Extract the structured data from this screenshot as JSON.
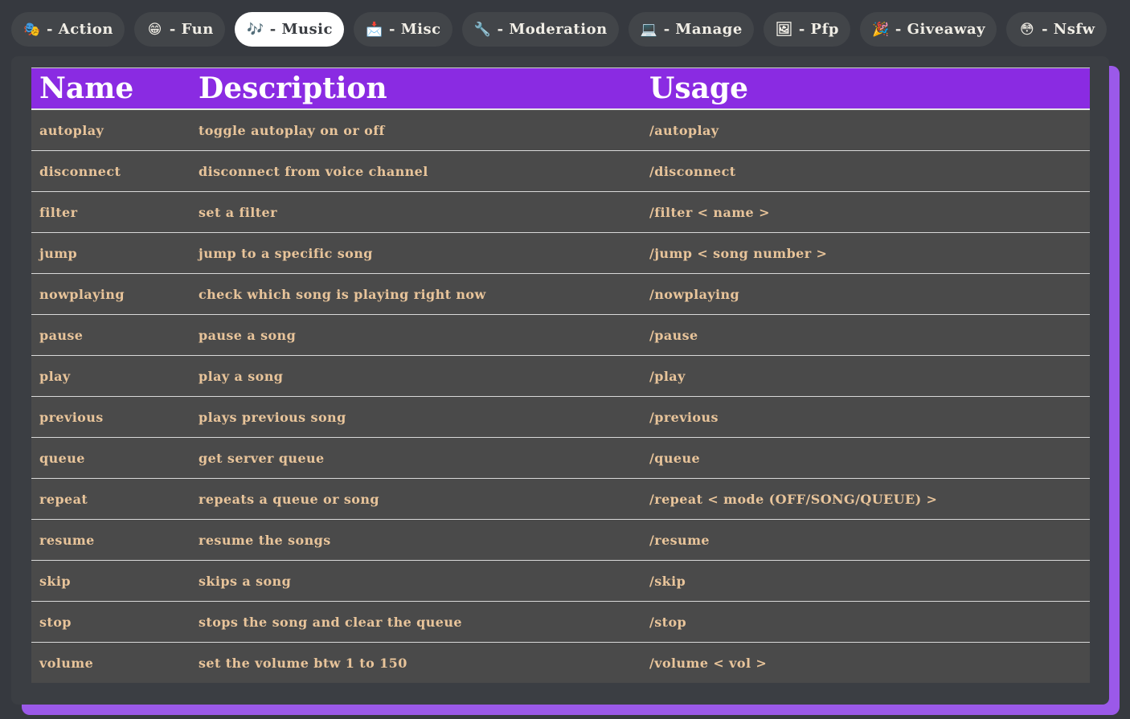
{
  "tabs": [
    {
      "icon": "theater-masks-icon",
      "glyph": "🎭",
      "label": "- Action",
      "active": false
    },
    {
      "icon": "grinning-face-icon",
      "glyph": "😁",
      "label": "- Fun",
      "active": false
    },
    {
      "icon": "music-notes-icon",
      "glyph": "🎶",
      "label": "- Music",
      "active": true
    },
    {
      "icon": "envelope-icon",
      "glyph": "📩",
      "label": "- Misc",
      "active": false
    },
    {
      "icon": "wrench-icon",
      "glyph": "🔧",
      "label": "- Moderation",
      "active": false
    },
    {
      "icon": "computer-icon",
      "glyph": "💻",
      "label": "- Manage",
      "active": false
    },
    {
      "icon": "picture-icon",
      "glyph": "🖼",
      "label": "- Pfp",
      "active": false
    },
    {
      "icon": "party-popper-icon",
      "glyph": "🎉",
      "label": "- Giveaway",
      "active": false
    },
    {
      "icon": "face-icon",
      "glyph": "😳",
      "label": "- Nsfw",
      "active": false
    }
  ],
  "table": {
    "headers": [
      "Name",
      "Description",
      "Usage"
    ],
    "rows": [
      [
        "autoplay",
        "toggle autoplay on or off",
        "/autoplay"
      ],
      [
        "disconnect",
        "disconnect from voice channel",
        "/disconnect"
      ],
      [
        "filter",
        "set a filter",
        "/filter < name >"
      ],
      [
        "jump",
        "jump to a specific song",
        "/jump < song number >"
      ],
      [
        "nowplaying",
        "check which song is playing right now",
        "/nowplaying"
      ],
      [
        "pause",
        "pause a song",
        "/pause"
      ],
      [
        "play",
        "play a song",
        "/play"
      ],
      [
        "previous",
        "plays previous song",
        "/previous"
      ],
      [
        "queue",
        "get server queue",
        "/queue"
      ],
      [
        "repeat",
        "repeats a queue or song",
        "/repeat < mode (OFF/SONG/QUEUE) >"
      ],
      [
        "resume",
        "resume the songs",
        "/resume"
      ],
      [
        "skip",
        "skips a song",
        "/skip"
      ],
      [
        "stop",
        "stops the song and clear the queue",
        "/stop"
      ],
      [
        "volume",
        "set the volume btw 1 to 150",
        "/volume < vol >"
      ]
    ]
  },
  "colors": {
    "background": "#36393f",
    "tab": "#424549",
    "active_tab": "#ffffff",
    "header": "#8a2be2",
    "row": "#4a4a4a",
    "row_text": "#e8c49a",
    "shadow": "#9b59e9"
  }
}
